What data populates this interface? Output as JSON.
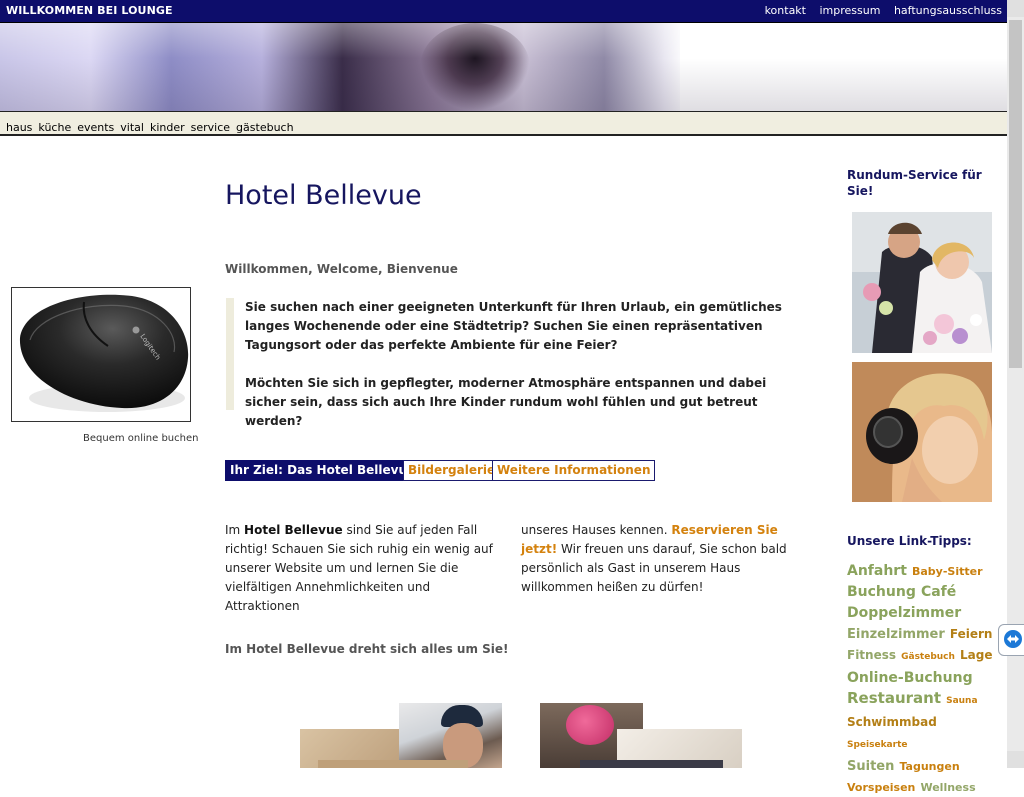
{
  "header": {
    "site_title": "WILLKOMMEN BEI LOUNGE",
    "links": [
      "kontakt",
      "impressum",
      "haftungsausschluss"
    ]
  },
  "nav": {
    "items": [
      "haus",
      "küche",
      "events",
      "vital",
      "kinder",
      "service",
      "gästebuch"
    ]
  },
  "left": {
    "image_caption": "Bequem online buchen",
    "logo_text": "Logitech"
  },
  "main": {
    "title": "Hotel Bellevue",
    "welcome": "Willkommen, Welcome, Bienvenue",
    "intro": [
      "Sie suchen nach einer geeigneten Unterkunft für Ihren Urlaub, ein gemütliches langes Wochenende oder eine Städtetrip? Suchen Sie einen repräsentativen Tagungsort oder das perfekte Ambiente für eine Feier?",
      "Möchten Sie sich in gepflegter, moderner Atmosphäre entspannen und dabei sicher sein, dass sich auch Ihre Kinder rundum wohl fühlen und gut betreut werden?"
    ],
    "buttons": {
      "ziel": "Ihr Ziel: Das Hotel Bellevue",
      "galerie": "Bildergalerie",
      "info": "Weitere Informationen"
    },
    "col1": {
      "prefix": "Im ",
      "hotel_name": "Hotel Bellevue",
      "text": " sind Sie auf jeden Fall richtig! Schauen Sie sich ruhig ein wenig auf unserer Website um und lernen Sie die vielfältigen Annehmlichkeiten und Attraktionen"
    },
    "col2": {
      "text": "unseres Hauses kennen. ",
      "cta": "Reservieren Sie jetzt!",
      "text2": " Wir freuen uns darauf, Sie schon bald persönlich als Gast in unserem Haus willkommen heißen zu dürfen!"
    },
    "tagline": "Im Hotel Bellevue dreht sich alles um Sie!"
  },
  "right": {
    "service_title": "Rundum-Service für Sie!",
    "link_title": "Unsere Link-Tipps:",
    "tags": [
      "Anfahrt",
      "Baby-Sitter",
      "Buchung",
      "Café",
      "Doppelzimmer",
      "Einzelzimmer",
      "Feiern",
      "Fitness",
      "Gästebuch",
      "Lage",
      "Online-Buchung",
      "Restaurant",
      "Sauna",
      "Schwimmbad",
      "Speisekarte",
      "Suiten",
      "Tagungen",
      "Vorspeisen",
      "Wellness"
    ]
  },
  "colors": {
    "header_bg": "#0d0d6b",
    "title": "#16165f",
    "accent_orange": "#d4820e",
    "tag_green": "#8aa35c"
  }
}
